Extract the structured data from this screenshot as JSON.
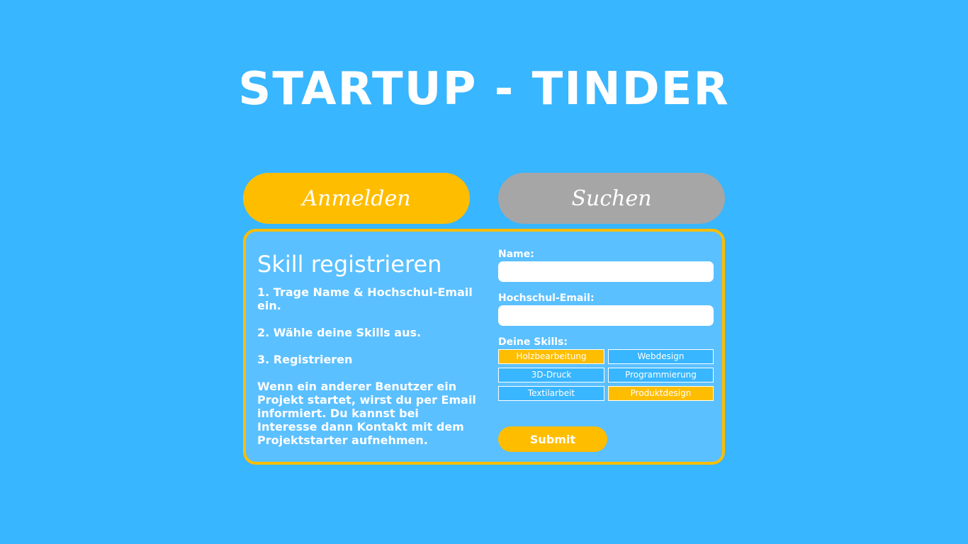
{
  "app": {
    "title": "STARTUP - TINDER"
  },
  "tabs": [
    {
      "label": "Anmelden",
      "active": true
    },
    {
      "label": "Suchen",
      "active": false
    }
  ],
  "panel": {
    "title": "Skill registrieren",
    "steps": [
      "1. Trage Name & Hochschul-Email ein.",
      "2. Wähle deine Skills aus.",
      "3. Registrieren"
    ],
    "info": "Wenn ein anderer Benutzer ein Projekt startet, wirst du per Email informiert. Du kannst bei Interesse dann Kontakt mit dem Projektstarter aufnehmen."
  },
  "form": {
    "name_label": "Name:",
    "name_value": "",
    "email_label": "Hochschul-Email:",
    "email_value": "",
    "skills_label": "Deine Skills:",
    "skills": [
      {
        "label": "Holzbearbeitung",
        "selected": true
      },
      {
        "label": "Webdesign",
        "selected": false
      },
      {
        "label": "3D-Druck",
        "selected": false
      },
      {
        "label": "Programmierung",
        "selected": false
      },
      {
        "label": "Textilarbeit",
        "selected": false
      },
      {
        "label": "Produktdesign",
        "selected": true
      }
    ],
    "submit_label": "Submit"
  },
  "colors": {
    "background": "#38b6ff",
    "panel": "#5bc0ff",
    "accent": "#ffbd00",
    "inactive_tab": "#a6a6a6",
    "text": "#ffffff"
  }
}
